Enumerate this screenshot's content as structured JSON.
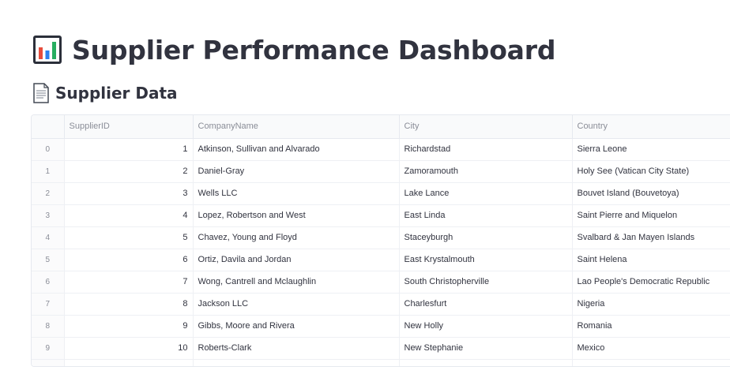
{
  "header": {
    "title": "Supplier Performance Dashboard",
    "title_icon": "bar-chart-icon"
  },
  "section": {
    "subtitle": "Supplier Data",
    "subtitle_icon": "page-icon"
  },
  "table": {
    "columns": [
      "",
      "SupplierID",
      "CompanyName",
      "City",
      "Country"
    ],
    "rows": [
      [
        "0",
        "1",
        "Atkinson, Sullivan and Alvarado",
        "Richardstad",
        "Sierra Leone"
      ],
      [
        "1",
        "2",
        "Daniel-Gray",
        "Zamoramouth",
        "Holy See (Vatican City State)"
      ],
      [
        "2",
        "3",
        "Wells LLC",
        "Lake Lance",
        "Bouvet Island (Bouvetoya)"
      ],
      [
        "3",
        "4",
        "Lopez, Robertson and West",
        "East Linda",
        "Saint Pierre and Miquelon"
      ],
      [
        "4",
        "5",
        "Chavez, Young and Floyd",
        "Staceyburgh",
        "Svalbard & Jan Mayen Islands"
      ],
      [
        "5",
        "6",
        "Ortiz, Davila and Jordan",
        "East Krystalmouth",
        "Saint Helena"
      ],
      [
        "6",
        "7",
        "Wong, Cantrell and Mclaughlin",
        "South Christopherville",
        "Lao People's Democratic Republic"
      ],
      [
        "7",
        "8",
        "Jackson LLC",
        "Charlesfurt",
        "Nigeria"
      ],
      [
        "8",
        "9",
        "Gibbs, Moore and Rivera",
        "New Holly",
        "Romania"
      ],
      [
        "9",
        "10",
        "Roberts-Clark",
        "New Stephanie",
        "Mexico"
      ]
    ]
  },
  "colors": {
    "text": "#31333f",
    "muted": "#8a8d97",
    "border": "#e6e9ef",
    "header_bg": "#f9fafb"
  }
}
